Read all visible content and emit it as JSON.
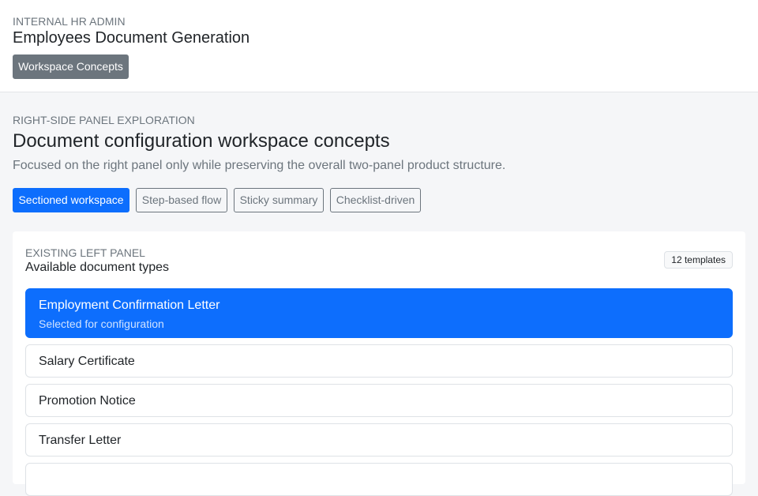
{
  "header": {
    "eyebrow": "INTERNAL HR ADMIN",
    "title": "Employees Document Generation",
    "workspace_button": "Workspace Concepts"
  },
  "section": {
    "eyebrow": "RIGHT-SIDE PANEL EXPLORATION",
    "title": "Document configuration workspace concepts",
    "description": "Focused on the right panel only while preserving the overall two-panel product structure."
  },
  "tabs": [
    {
      "label": "Sectioned workspace",
      "active": true
    },
    {
      "label": "Step-based flow",
      "active": false
    },
    {
      "label": "Sticky summary",
      "active": false
    },
    {
      "label": "Checklist-driven",
      "active": false
    }
  ],
  "left_panel": {
    "eyebrow": "EXISTING LEFT PANEL",
    "title": "Available document types",
    "count_badge": "12 templates",
    "documents": [
      {
        "label": "Employment Confirmation Letter",
        "sub": "Selected for configuration",
        "selected": true
      },
      {
        "label": "Salary Certificate",
        "selected": false
      },
      {
        "label": "Promotion Notice",
        "selected": false
      },
      {
        "label": "Transfer Letter",
        "selected": false
      },
      {
        "label": "",
        "selected": false
      }
    ]
  },
  "colors": {
    "primary": "#0d6efd",
    "secondary": "#6c757d",
    "background": "#f5f6f8"
  }
}
